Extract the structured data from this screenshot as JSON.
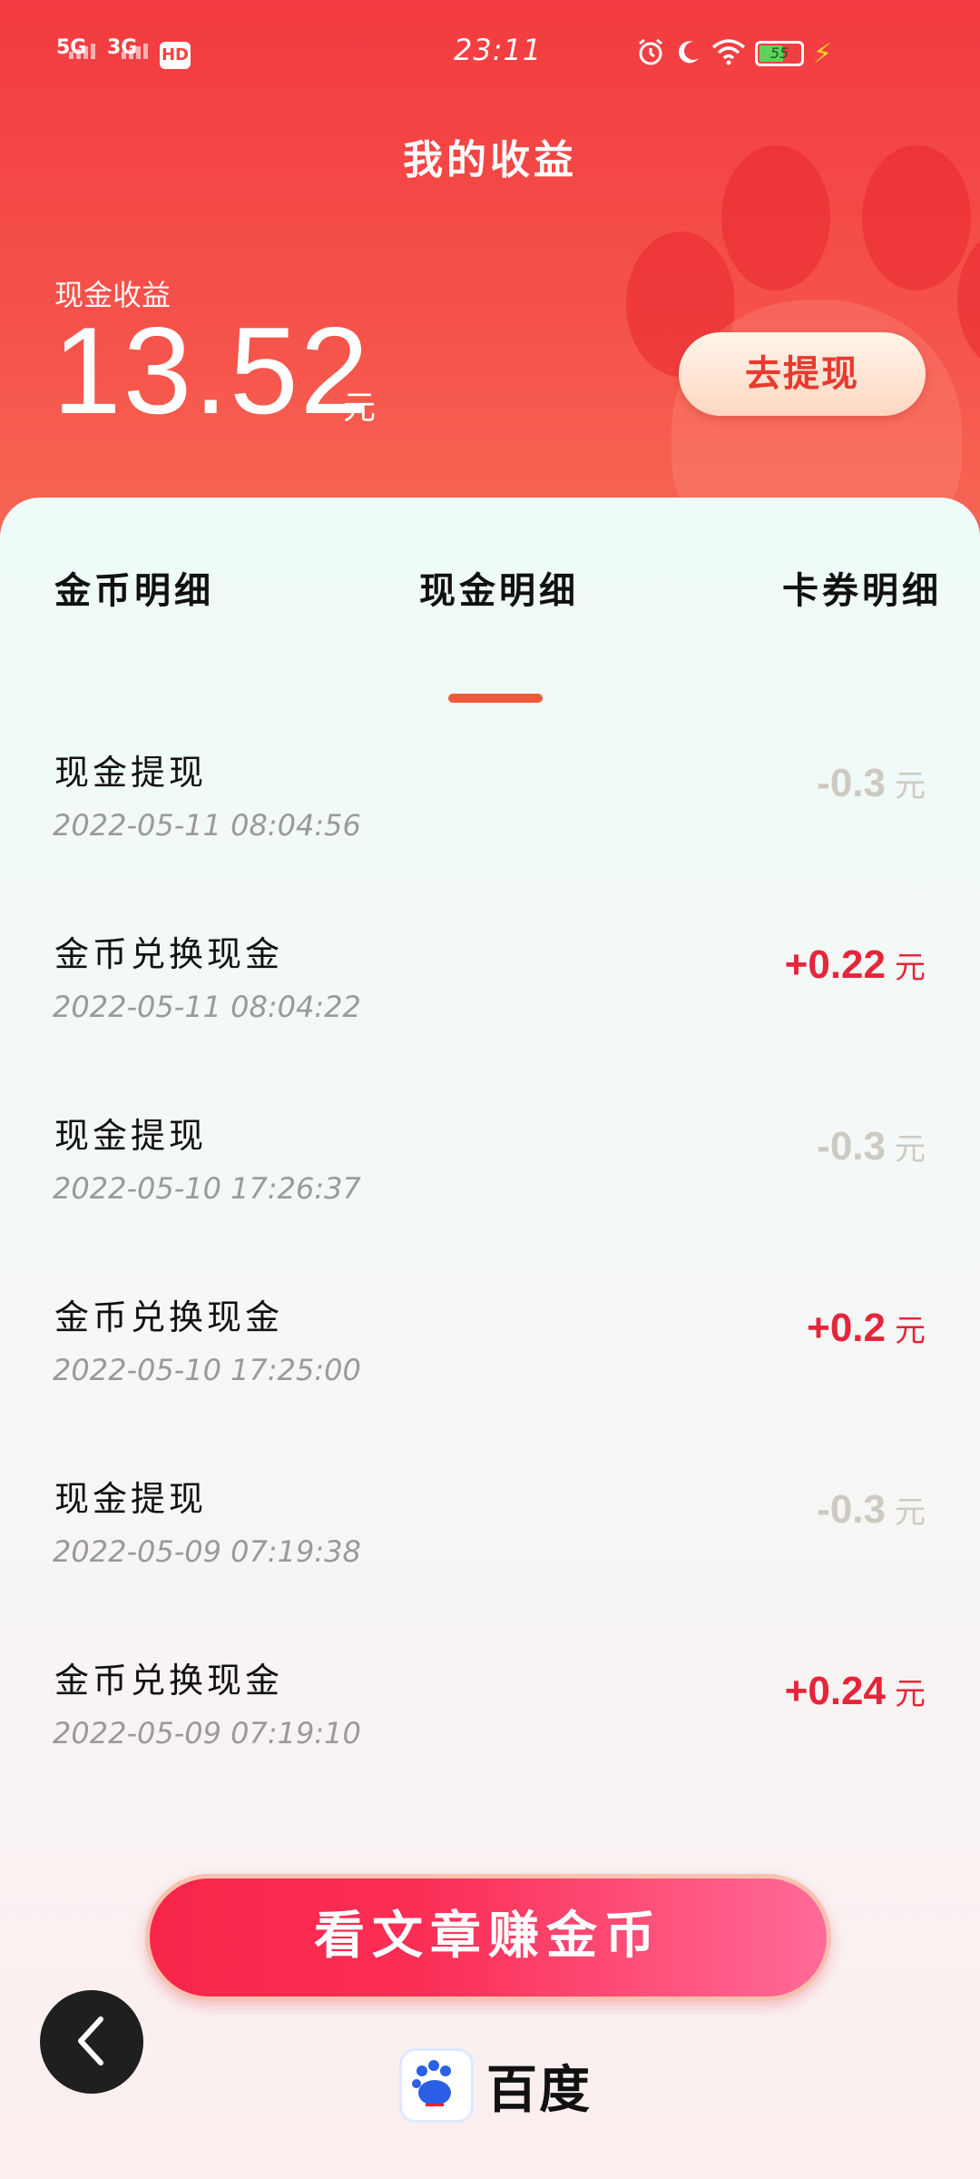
{
  "status_bar": {
    "sim1": "5G",
    "sim2": "3G",
    "hd": "HD",
    "time": "23:11",
    "battery": "55",
    "icons": [
      "alarm-icon",
      "moon-icon",
      "wifi-icon",
      "battery-icon",
      "charging-bolt-icon"
    ]
  },
  "header": {
    "title": "我的收益",
    "cash_label": "现金收益",
    "cash_amount": "13.52",
    "unit": "元",
    "withdraw_label": "去提现"
  },
  "tabs": [
    {
      "label": "金币明细"
    },
    {
      "label": "现金明细",
      "active": true
    },
    {
      "label": "卡券明细"
    }
  ],
  "transactions": [
    {
      "name": "现金提现",
      "date": "2022-05-11 08:04:56",
      "amount": "-0.3",
      "unit": "元",
      "type": "neg"
    },
    {
      "name": "金币兑换现金",
      "date": "2022-05-11 08:04:22",
      "amount": "+0.22",
      "unit": "元",
      "type": "pos"
    },
    {
      "name": "现金提现",
      "date": "2022-05-10 17:26:37",
      "amount": "-0.3",
      "unit": "元",
      "type": "neg"
    },
    {
      "name": "金币兑换现金",
      "date": "2022-05-10 17:25:00",
      "amount": "+0.2",
      "unit": "元",
      "type": "pos"
    },
    {
      "name": "现金提现",
      "date": "2022-05-09 07:19:38",
      "amount": "-0.3",
      "unit": "元",
      "type": "neg"
    },
    {
      "name": "金币兑换现金",
      "date": "2022-05-09 07:19:10",
      "amount": "+0.24",
      "unit": "元",
      "type": "pos"
    }
  ],
  "cta": {
    "label": "看文章赚金币"
  },
  "brand": {
    "name": "百度"
  },
  "colors": {
    "header_red": "#f23b40",
    "positive": "#e6253a",
    "negative": "#cdcac2",
    "tab_indicator": "#f25a3c"
  }
}
